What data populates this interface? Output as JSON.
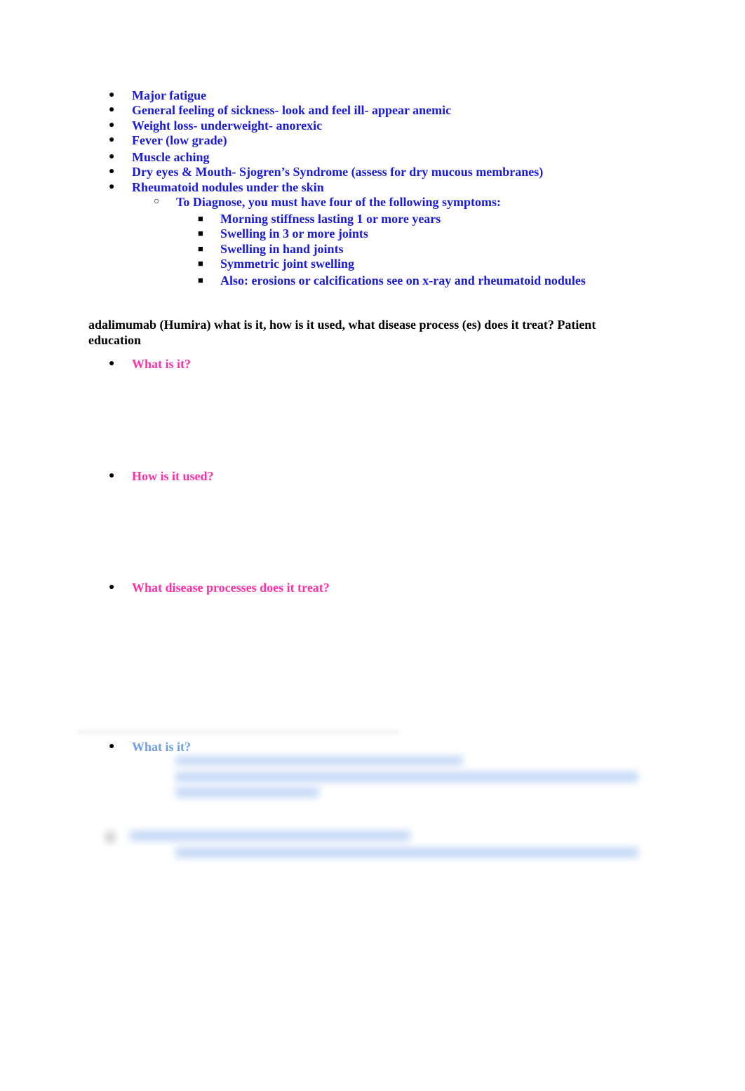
{
  "symptoms": {
    "items": [
      "Major fatigue",
      "General feeling of sickness- look and feel ill- appear anemic",
      "Weight loss- underweight- anorexic",
      "Fever (low grade)",
      "Muscle aching",
      "Dry eyes & Mouth- Sjogren’s Syndrome (assess for dry mucous membranes)",
      "Rheumatoid nodules under the skin"
    ],
    "diagnose": {
      "label": "To Diagnose, you must have four of the following symptoms:",
      "criteria": [
        "Morning stiffness lasting 1 or more years",
        "Swelling in 3 or more joints",
        "Swelling in hand joints",
        "Symmetric joint swelling",
        "Also: erosions or calcifications see on x-ray and rheumatoid nodules"
      ]
    }
  },
  "question": {
    "heading": "adalimumab (Humira) what is it, how is it used, what disease process (es) does it treat?  Patient education",
    "prompts": [
      "What is it?",
      "How is it used?",
      "What disease processes does it treat?"
    ]
  },
  "preview": {
    "prompt": "What is it?"
  },
  "colors": {
    "answer_text": "#1a1adb",
    "prompt_text": "#ff2fa8",
    "preview_text": "#6f9de6"
  }
}
